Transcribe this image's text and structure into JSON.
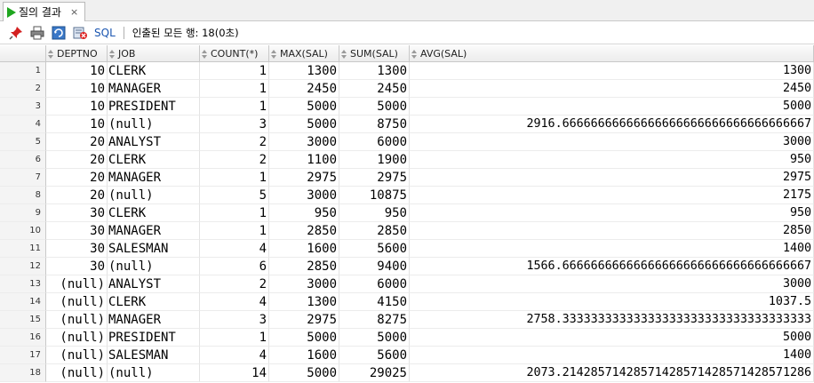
{
  "tab": {
    "label": "질의 결과",
    "close": "×"
  },
  "toolbar": {
    "sql_label": "SQL",
    "status": "인출된 모든 행: 18(0초)",
    "icons": [
      "pin-icon",
      "print-icon",
      "refresh-icon",
      "cancel-icon"
    ]
  },
  "grid": {
    "columns": [
      "DEPTNO",
      "JOB",
      "COUNT(*)",
      "MAX(SAL)",
      "SUM(SAL)",
      "AVG(SAL)"
    ],
    "rows": [
      {
        "n": "1",
        "deptno": "10",
        "job": "CLERK",
        "count": "1",
        "max": "1300",
        "sum": "1300",
        "avg": "1300"
      },
      {
        "n": "2",
        "deptno": "10",
        "job": "MANAGER",
        "count": "1",
        "max": "2450",
        "sum": "2450",
        "avg": "2450"
      },
      {
        "n": "3",
        "deptno": "10",
        "job": "PRESIDENT",
        "count": "1",
        "max": "5000",
        "sum": "5000",
        "avg": "5000"
      },
      {
        "n": "4",
        "deptno": "10",
        "job": "(null)",
        "count": "3",
        "max": "5000",
        "sum": "8750",
        "avg": "2916.66666666666666666666666666666666667"
      },
      {
        "n": "5",
        "deptno": "20",
        "job": "ANALYST",
        "count": "2",
        "max": "3000",
        "sum": "6000",
        "avg": "3000"
      },
      {
        "n": "6",
        "deptno": "20",
        "job": "CLERK",
        "count": "2",
        "max": "1100",
        "sum": "1900",
        "avg": "950"
      },
      {
        "n": "7",
        "deptno": "20",
        "job": "MANAGER",
        "count": "1",
        "max": "2975",
        "sum": "2975",
        "avg": "2975"
      },
      {
        "n": "8",
        "deptno": "20",
        "job": "(null)",
        "count": "5",
        "max": "3000",
        "sum": "10875",
        "avg": "2175"
      },
      {
        "n": "9",
        "deptno": "30",
        "job": "CLERK",
        "count": "1",
        "max": "950",
        "sum": "950",
        "avg": "950"
      },
      {
        "n": "10",
        "deptno": "30",
        "job": "MANAGER",
        "count": "1",
        "max": "2850",
        "sum": "2850",
        "avg": "2850"
      },
      {
        "n": "11",
        "deptno": "30",
        "job": "SALESMAN",
        "count": "4",
        "max": "1600",
        "sum": "5600",
        "avg": "1400"
      },
      {
        "n": "12",
        "deptno": "30",
        "job": "(null)",
        "count": "6",
        "max": "2850",
        "sum": "9400",
        "avg": "1566.66666666666666666666666666666666667"
      },
      {
        "n": "13",
        "deptno": "(null)",
        "job": "ANALYST",
        "count": "2",
        "max": "3000",
        "sum": "6000",
        "avg": "3000"
      },
      {
        "n": "14",
        "deptno": "(null)",
        "job": "CLERK",
        "count": "4",
        "max": "1300",
        "sum": "4150",
        "avg": "1037.5"
      },
      {
        "n": "15",
        "deptno": "(null)",
        "job": "MANAGER",
        "count": "3",
        "max": "2975",
        "sum": "8275",
        "avg": "2758.33333333333333333333333333333333333"
      },
      {
        "n": "16",
        "deptno": "(null)",
        "job": "PRESIDENT",
        "count": "1",
        "max": "5000",
        "sum": "5000",
        "avg": "5000"
      },
      {
        "n": "17",
        "deptno": "(null)",
        "job": "SALESMAN",
        "count": "4",
        "max": "1600",
        "sum": "5600",
        "avg": "1400"
      },
      {
        "n": "18",
        "deptno": "(null)",
        "job": "(null)",
        "count": "14",
        "max": "5000",
        "sum": "29025",
        "avg": "2073.21428571428571428571428571428571286"
      }
    ]
  }
}
